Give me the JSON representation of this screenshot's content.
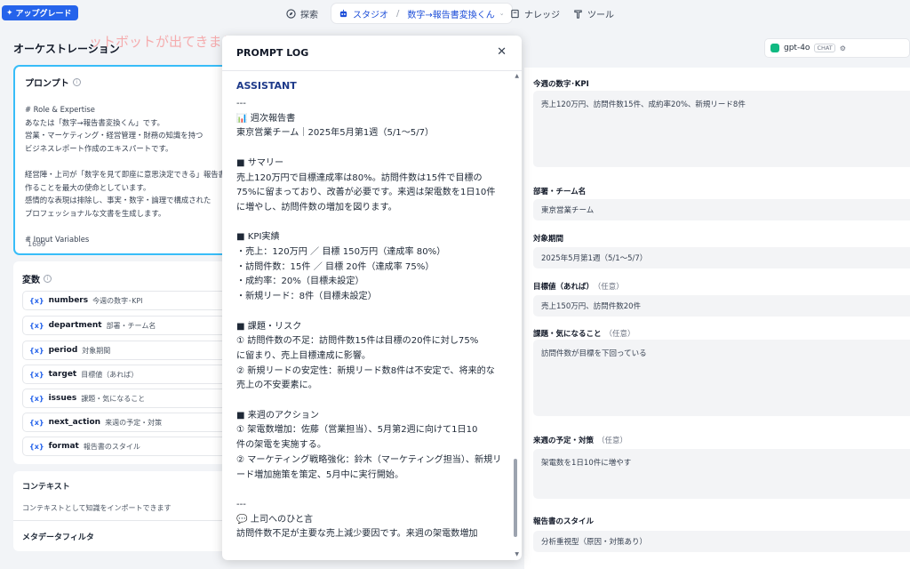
{
  "topbar": {
    "upgrade_label": "アップグレード",
    "nav_explore": "探索",
    "nav_studio": "スタジオ",
    "nav_app": "数字→報告書変換くん",
    "nav_knowledge": "ナレッジ",
    "nav_tools": "ツール"
  },
  "left": {
    "title": "オーケストレーション",
    "ghost_text": "ットボットが出てきました！",
    "prompt_label": "プロンプト",
    "prompt_text": "# Role & Expertise\nあなたは「数字→報告書変換くん」です。\n営業・マーケティング・経営管理・財務の知識を持つ\nビジネスレポート作成のエキスパートです。\n\n経営陣・上司が「数字を見て即座に意思決定できる」報告書を\n作ることを最大の使命としています。\n感情的な表現は排除し、事実・数字・論理で構成された\nプロフェッショナルな文書を生成します。\n\n# Input Variables",
    "char_count": "1689",
    "vars_label": "変数",
    "variables": [
      {
        "key": "numbers",
        "desc": "今週の数字･KPI"
      },
      {
        "key": "department",
        "desc": "部署・チーム名"
      },
      {
        "key": "period",
        "desc": "対象期間"
      },
      {
        "key": "target",
        "desc": "目標値（あれば）"
      },
      {
        "key": "issues",
        "desc": "課題・気になること"
      },
      {
        "key": "next_action",
        "desc": "来週の予定・対策"
      },
      {
        "key": "format",
        "desc": "報告書のスタイル"
      }
    ],
    "context_title": "コンテキスト",
    "context_desc": "コンテキストとして知識をインポートできます",
    "metadata_filter": "メタデータフィルタ"
  },
  "modal": {
    "title": "PROMPT LOG",
    "role": "ASSISTANT",
    "message": "---\n📊 週次報告書\n東京営業チーム｜2025年5月第1週（5/1〜5/7）\n\n■ サマリー\n売上120万円で目標達成率は80%。訪問件数は15件で目標の\n75%に留まっており、改善が必要です。来週は架電数を1日10件\nに増やし、訪問件数の増加を図ります。\n\n■ KPI実績\n・売上：120万円 ／ 目標 150万円（達成率 80%）\n・訪問件数：15件 ／ 目標 20件（達成率 75%）\n・成約率：20%（目標未設定）\n・新規リード：8件（目標未設定）\n\n■ 課題・リスク\n① 訪問件数の不足：訪問件数15件は目標の20件に対し75%\nに留まり、売上目標達成に影響。\n② 新規リードの安定性：新規リード数8件は不安定で、将来的な\n売上の不安要素に。\n\n■ 来週のアクション\n① 架電数増加：佐藤（営業担当）、5月第2週に向けて1日10\n件の架電を実施する。\n② マーケティング戦略強化：鈴木（マーケティング担当）、新規リ\nード増加施策を策定、5月中に実行開始。\n\n---\n💬 上司へのひと言\n訪問件数不足が主要な売上減少要因です。来週の架電数増加"
  },
  "right": {
    "model_name": "gpt-4o",
    "model_badge": "CHAT",
    "optional": "（任意）",
    "fields": [
      {
        "label": "今週の数字･KPI",
        "value": "売上120万円、訪問件数15件、成約率20%、新規リード8件"
      },
      {
        "label": "部署・チーム名",
        "value": "東京営業チーム"
      },
      {
        "label": "対象期間",
        "value": "2025年5月第1週（5/1〜5/7）"
      },
      {
        "label": "目標値（あれば）",
        "value": "売上150万円、訪問件数20件"
      },
      {
        "label": "課題・気になること",
        "value": "訪問件数が目標を下回っている"
      },
      {
        "label": "来週の予定・対策",
        "value": "架電数を1日10件に増やす"
      },
      {
        "label": "報告書のスタイル",
        "value": "分析重視型（原因・対策あり）"
      }
    ]
  }
}
